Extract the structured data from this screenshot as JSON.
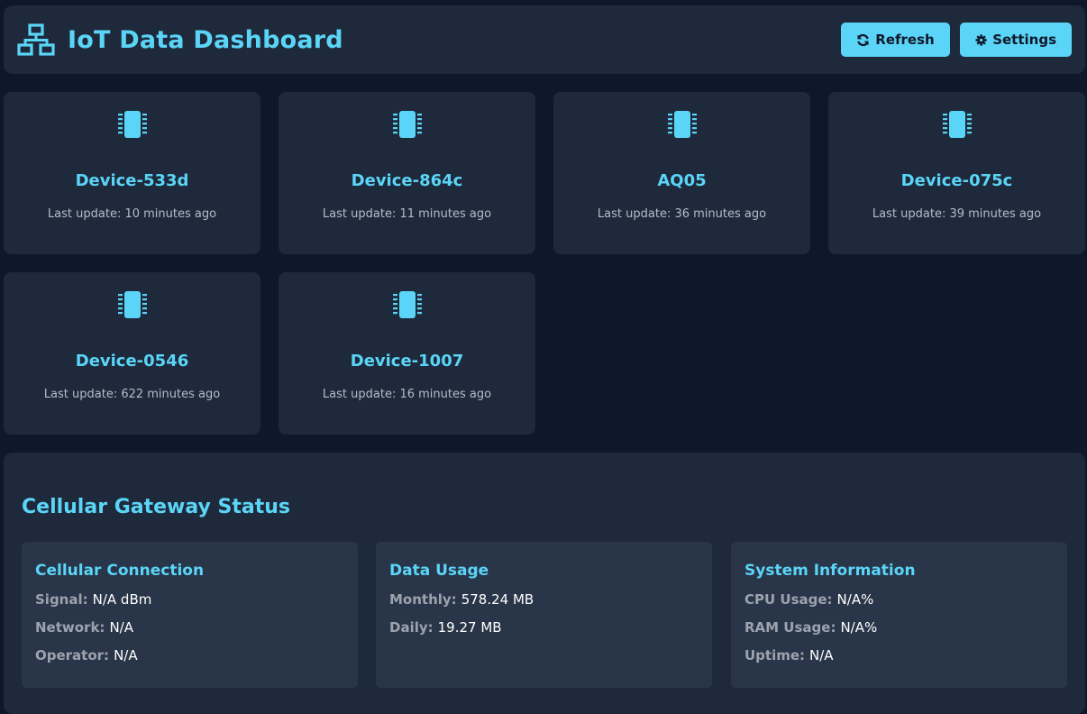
{
  "header": {
    "title": "IoT Data Dashboard",
    "refresh_label": "Refresh",
    "settings_label": "Settings"
  },
  "devices": [
    {
      "name": "Device-533d",
      "update": "Last update: 10 minutes ago"
    },
    {
      "name": "Device-864c",
      "update": "Last update: 11 minutes ago"
    },
    {
      "name": "AQ05",
      "update": "Last update: 36 minutes ago"
    },
    {
      "name": "Device-075c",
      "update": "Last update: 39 minutes ago"
    },
    {
      "name": "Device-0546",
      "update": "Last update: 622 minutes ago"
    },
    {
      "name": "Device-1007",
      "update": "Last update: 16 minutes ago"
    }
  ],
  "gateway": {
    "title": "Cellular Gateway Status",
    "cellular": {
      "title": "Cellular Connection",
      "signal_label": "Signal:",
      "signal_value": "N/A dBm",
      "network_label": "Network:",
      "network_value": "N/A",
      "operator_label": "Operator:",
      "operator_value": "N/A"
    },
    "data_usage": {
      "title": "Data Usage",
      "monthly_label": "Monthly:",
      "monthly_value": "578.24 MB",
      "daily_label": "Daily:",
      "daily_value": "19.27 MB"
    },
    "system": {
      "title": "System Information",
      "cpu_label": "CPU Usage:",
      "cpu_value": "N/A%",
      "ram_label": "RAM Usage:",
      "ram_value": "N/A%",
      "uptime_label": "Uptime:",
      "uptime_value": "N/A"
    }
  },
  "colors": {
    "accent": "#5bd5f7",
    "background": "#0f172a",
    "card": "#1e293b",
    "panel": "#293548"
  },
  "icons": {
    "brand": "network-wired-icon",
    "device": "microchip-icon",
    "refresh": "sync-icon",
    "settings": "gear-icon"
  }
}
